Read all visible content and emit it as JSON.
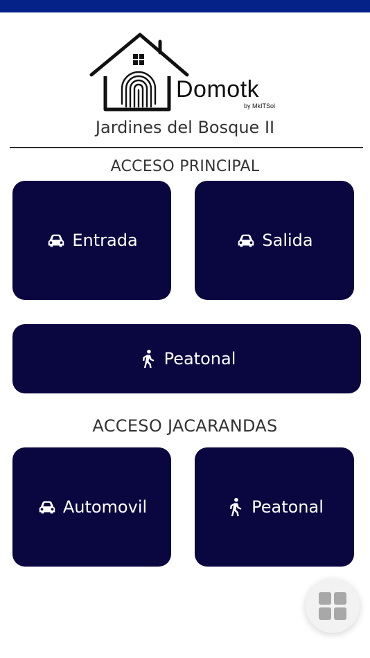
{
  "header": {
    "brand": "Domotk",
    "byline": "by MkITSol",
    "site_name": "Jardines del Bosque II"
  },
  "sections": [
    {
      "title": "ACCESO PRINCIPAL",
      "buttons": [
        {
          "label": "Entrada",
          "icon": "car-icon"
        },
        {
          "label": "Salida",
          "icon": "car-icon"
        },
        {
          "label": "Peatonal",
          "icon": "pedestrian-icon"
        }
      ]
    },
    {
      "title": "ACCESO JACARANDAS",
      "buttons": [
        {
          "label": "Automovil",
          "icon": "car-icon"
        },
        {
          "label": "Peatonal",
          "icon": "pedestrian-icon"
        }
      ]
    }
  ],
  "fab": {
    "icon": "grid-menu-icon"
  },
  "colors": {
    "status_bar": "#052289",
    "button_bg": "#0a0640",
    "button_text": "#ffffff",
    "fab_bg": "#f2f2f2"
  }
}
